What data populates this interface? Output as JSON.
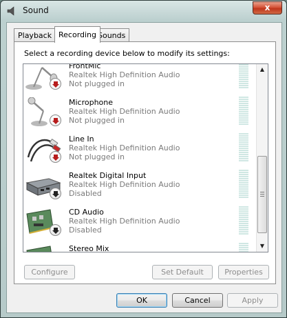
{
  "window": {
    "title": "Sound",
    "close_label": "x"
  },
  "tabs": [
    {
      "label": "Playback",
      "active": false
    },
    {
      "label": "Recording",
      "active": true
    },
    {
      "label": "Sounds",
      "active": false
    }
  ],
  "instruction": "Select a recording device below to modify its settings:",
  "devices": [
    {
      "name": "FrontMic",
      "driver": "Realtek High Definition Audio",
      "status": "Not plugged in",
      "icon": "microphone-icon",
      "badge": "red-down-arrow"
    },
    {
      "name": "Microphone",
      "driver": "Realtek High Definition Audio",
      "status": "Not plugged in",
      "icon": "microphone-icon",
      "badge": "red-down-arrow"
    },
    {
      "name": "Line In",
      "driver": "Realtek High Definition Audio",
      "status": "Not plugged in",
      "icon": "rca-cable-icon",
      "badge": "red-down-arrow"
    },
    {
      "name": "Realtek Digital Input",
      "driver": "Realtek High Definition Audio",
      "status": "Disabled",
      "icon": "digital-input-icon",
      "badge": "black-down-arrow"
    },
    {
      "name": "CD Audio",
      "driver": "Realtek High Definition Audio",
      "status": "Disabled",
      "icon": "sound-card-icon",
      "badge": "black-down-arrow"
    },
    {
      "name": "Stereo Mix",
      "driver": "",
      "status": "",
      "icon": "sound-card-icon",
      "badge": ""
    }
  ],
  "panel_buttons": {
    "configure": "Configure",
    "set_default": "Set Default",
    "properties": "Properties"
  },
  "dialog_buttons": {
    "ok": "OK",
    "cancel": "Cancel",
    "apply": "Apply"
  },
  "colors": {
    "accent": "#3c7fb1",
    "close": "#c0351b",
    "meter": "#cfe7e3",
    "badge_red": "#b71c1c"
  }
}
